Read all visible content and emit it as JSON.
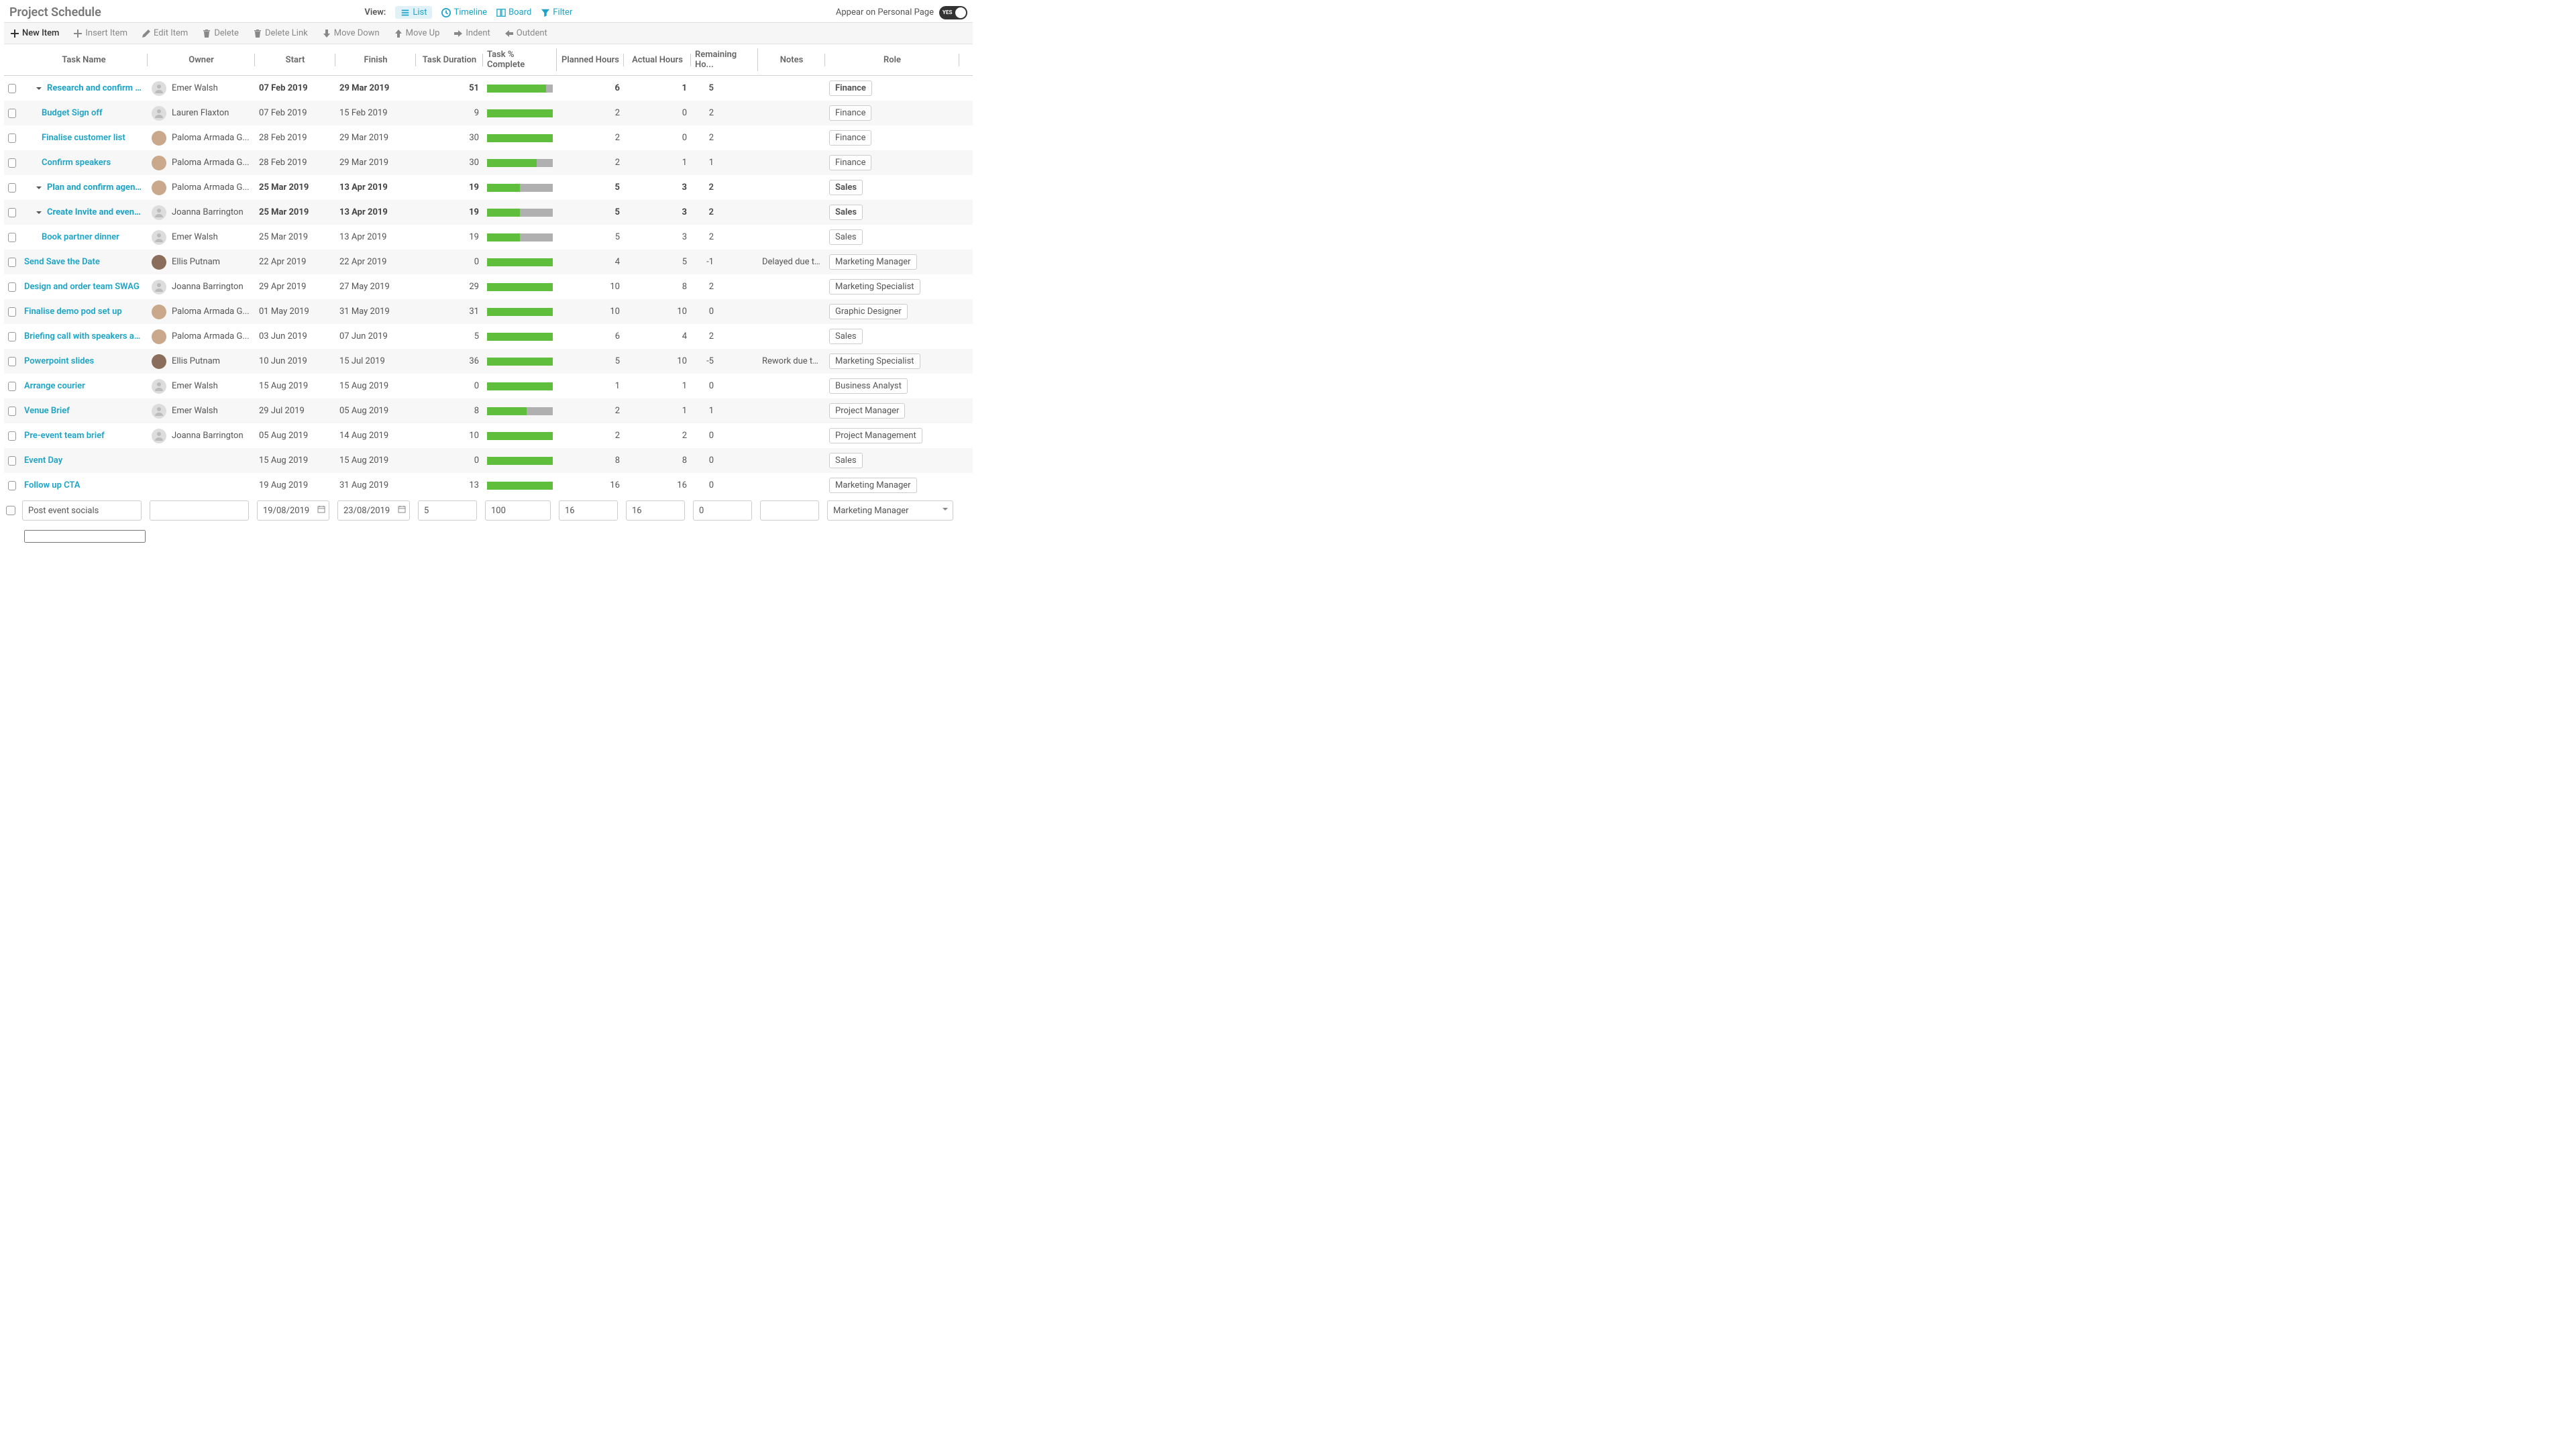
{
  "header": {
    "title": "Project Schedule",
    "view_label": "View:",
    "views": {
      "list": "List",
      "timeline": "Timeline",
      "board": "Board",
      "filter": "Filter"
    },
    "personal_page_label": "Appear on Personal Page",
    "toggle_text": "YES"
  },
  "toolbar": {
    "new_item": "New Item",
    "insert_item": "Insert Item",
    "edit_item": "Edit Item",
    "delete": "Delete",
    "delete_link": "Delete Link",
    "move_down": "Move Down",
    "move_up": "Move Up",
    "indent": "Indent",
    "outdent": "Outdent"
  },
  "columns": {
    "task_name": "Task Name",
    "owner": "Owner",
    "start": "Start",
    "finish": "Finish",
    "duration": "Task Duration",
    "pct_complete": "Task % Complete",
    "planned_hours": "Planned Hours",
    "actual_hours": "Actual Hours",
    "remaining_hours": "Remaining Ho...",
    "notes": "Notes",
    "role": "Role"
  },
  "tasks": [
    {
      "name": "Research and confirm venue",
      "indent": 1,
      "expander": true,
      "owner": "Emer Walsh",
      "avatar": "grey",
      "start": "07 Feb 2019",
      "finish": "29 Mar 2019",
      "bold_dates": true,
      "duration": "51",
      "pct": 90,
      "planned": "6",
      "actual": "1",
      "remaining": "5",
      "note": "",
      "role": "Finance"
    },
    {
      "name": "Budget Sign off",
      "indent": 2,
      "expander": false,
      "owner": "Lauren Flaxton",
      "avatar": "grey",
      "start": "07 Feb 2019",
      "finish": "15 Feb 2019",
      "bold_dates": false,
      "duration": "9",
      "pct": 100,
      "planned": "2",
      "actual": "0",
      "remaining": "2",
      "note": "",
      "role": "Finance"
    },
    {
      "name": "Finalise customer list",
      "indent": 2,
      "expander": false,
      "owner": "Paloma Armada G...",
      "avatar": "p1",
      "start": "28 Feb 2019",
      "finish": "29 Mar 2019",
      "bold_dates": false,
      "duration": "30",
      "pct": 100,
      "planned": "2",
      "actual": "0",
      "remaining": "2",
      "note": "",
      "role": "Finance"
    },
    {
      "name": "Confirm speakers",
      "indent": 2,
      "expander": false,
      "owner": "Paloma Armada G...",
      "avatar": "p1",
      "start": "28 Feb 2019",
      "finish": "29 Mar 2019",
      "bold_dates": false,
      "duration": "30",
      "pct": 75,
      "planned": "2",
      "actual": "1",
      "remaining": "1",
      "note": "",
      "role": "Finance"
    },
    {
      "name": "Plan and confirm agenda",
      "indent": 1,
      "expander": true,
      "owner": "Paloma Armada G...",
      "avatar": "p1",
      "start": "25 Mar 2019",
      "finish": "13 Apr 2019",
      "bold_dates": true,
      "duration": "19",
      "pct": 50,
      "planned": "5",
      "actual": "3",
      "remaining": "2",
      "note": "",
      "role": "Sales"
    },
    {
      "name": "Create Invite and event landi...",
      "indent": 1,
      "expander": true,
      "owner": "Joanna Barrington",
      "avatar": "grey",
      "start": "25 Mar 2019",
      "finish": "13 Apr 2019",
      "bold_dates": true,
      "duration": "19",
      "pct": 50,
      "planned": "5",
      "actual": "3",
      "remaining": "2",
      "note": "",
      "role": "Sales"
    },
    {
      "name": "Book partner dinner",
      "indent": 2,
      "expander": false,
      "owner": "Emer Walsh",
      "avatar": "grey",
      "start": "25 Mar 2019",
      "finish": "13 Apr 2019",
      "bold_dates": false,
      "duration": "19",
      "pct": 50,
      "planned": "5",
      "actual": "3",
      "remaining": "2",
      "note": "",
      "role": "Sales"
    },
    {
      "name": "Send Save the Date",
      "indent": 0,
      "expander": false,
      "owner": "Ellis Putnam",
      "avatar": "p2",
      "start": "22 Apr 2019",
      "finish": "22 Apr 2019",
      "bold_dates": false,
      "duration": "0",
      "pct": 100,
      "planned": "4",
      "actual": "5",
      "remaining": "-1",
      "note": "Delayed due to l...",
      "role": "Marketing Manager"
    },
    {
      "name": "Design and order team SWAG",
      "indent": 0,
      "expander": false,
      "owner": "Joanna Barrington",
      "avatar": "grey",
      "start": "29 Apr 2019",
      "finish": "27 May 2019",
      "bold_dates": false,
      "duration": "29",
      "pct": 100,
      "planned": "10",
      "actual": "8",
      "remaining": "2",
      "note": "",
      "role": "Marketing Specialist"
    },
    {
      "name": "Finalise demo pod set up",
      "indent": 0,
      "expander": false,
      "owner": "Paloma Armada G...",
      "avatar": "p1",
      "start": "01 May 2019",
      "finish": "31 May 2019",
      "bold_dates": false,
      "duration": "31",
      "pct": 100,
      "planned": "10",
      "actual": "10",
      "remaining": "0",
      "note": "",
      "role": "Graphic Designer"
    },
    {
      "name": "Briefing call with speakers and pa...",
      "indent": 0,
      "expander": false,
      "owner": "Paloma Armada G...",
      "avatar": "p1",
      "start": "03 Jun 2019",
      "finish": "07 Jun 2019",
      "bold_dates": false,
      "duration": "5",
      "pct": 100,
      "planned": "6",
      "actual": "4",
      "remaining": "2",
      "note": "",
      "role": "Sales"
    },
    {
      "name": "Powerpoint slides",
      "indent": 0,
      "expander": false,
      "owner": "Ellis Putnam",
      "avatar": "p2",
      "start": "10 Jun 2019",
      "finish": "15 Jul 2019",
      "bold_dates": false,
      "duration": "36",
      "pct": 100,
      "planned": "5",
      "actual": "10",
      "remaining": "-5",
      "note": "Rework due to r...",
      "role": "Marketing Specialist"
    },
    {
      "name": "Arrange courier",
      "indent": 0,
      "expander": false,
      "owner": "Emer Walsh",
      "avatar": "grey",
      "start": "15 Aug 2019",
      "finish": "15 Aug 2019",
      "bold_dates": false,
      "duration": "0",
      "pct": 100,
      "planned": "1",
      "actual": "1",
      "remaining": "0",
      "note": "",
      "role": "Business Analyst"
    },
    {
      "name": "Venue Brief",
      "indent": 0,
      "expander": false,
      "owner": "Emer Walsh",
      "avatar": "grey",
      "start": "29 Jul 2019",
      "finish": "05 Aug 2019",
      "bold_dates": false,
      "duration": "8",
      "pct": 60,
      "planned": "2",
      "actual": "1",
      "remaining": "1",
      "note": "",
      "role": "Project Manager"
    },
    {
      "name": "Pre-event team brief",
      "indent": 0,
      "expander": false,
      "owner": "Joanna Barrington",
      "avatar": "grey",
      "start": "05 Aug 2019",
      "finish": "14 Aug 2019",
      "bold_dates": false,
      "duration": "10",
      "pct": 100,
      "planned": "2",
      "actual": "2",
      "remaining": "0",
      "note": "",
      "role": "Project Management"
    },
    {
      "name": "Event Day",
      "indent": 0,
      "expander": false,
      "owner": "",
      "avatar": "none",
      "start": "15 Aug 2019",
      "finish": "15 Aug 2019",
      "bold_dates": false,
      "duration": "0",
      "pct": 100,
      "planned": "8",
      "actual": "8",
      "remaining": "0",
      "note": "",
      "role": "Sales"
    },
    {
      "name": "Follow up CTA",
      "indent": 0,
      "expander": false,
      "owner": "",
      "avatar": "none",
      "start": "19 Aug 2019",
      "finish": "31 Aug 2019",
      "bold_dates": false,
      "duration": "13",
      "pct": 100,
      "planned": "16",
      "actual": "16",
      "remaining": "0",
      "note": "",
      "role": "Marketing Manager"
    }
  ],
  "new_row": {
    "task_name": "Post event socials",
    "start": "19/08/2019",
    "finish": "23/08/2019",
    "duration": "5",
    "pct": "100",
    "planned": "16",
    "actual": "16",
    "remaining": "0",
    "notes": "",
    "role": "Marketing Manager"
  }
}
